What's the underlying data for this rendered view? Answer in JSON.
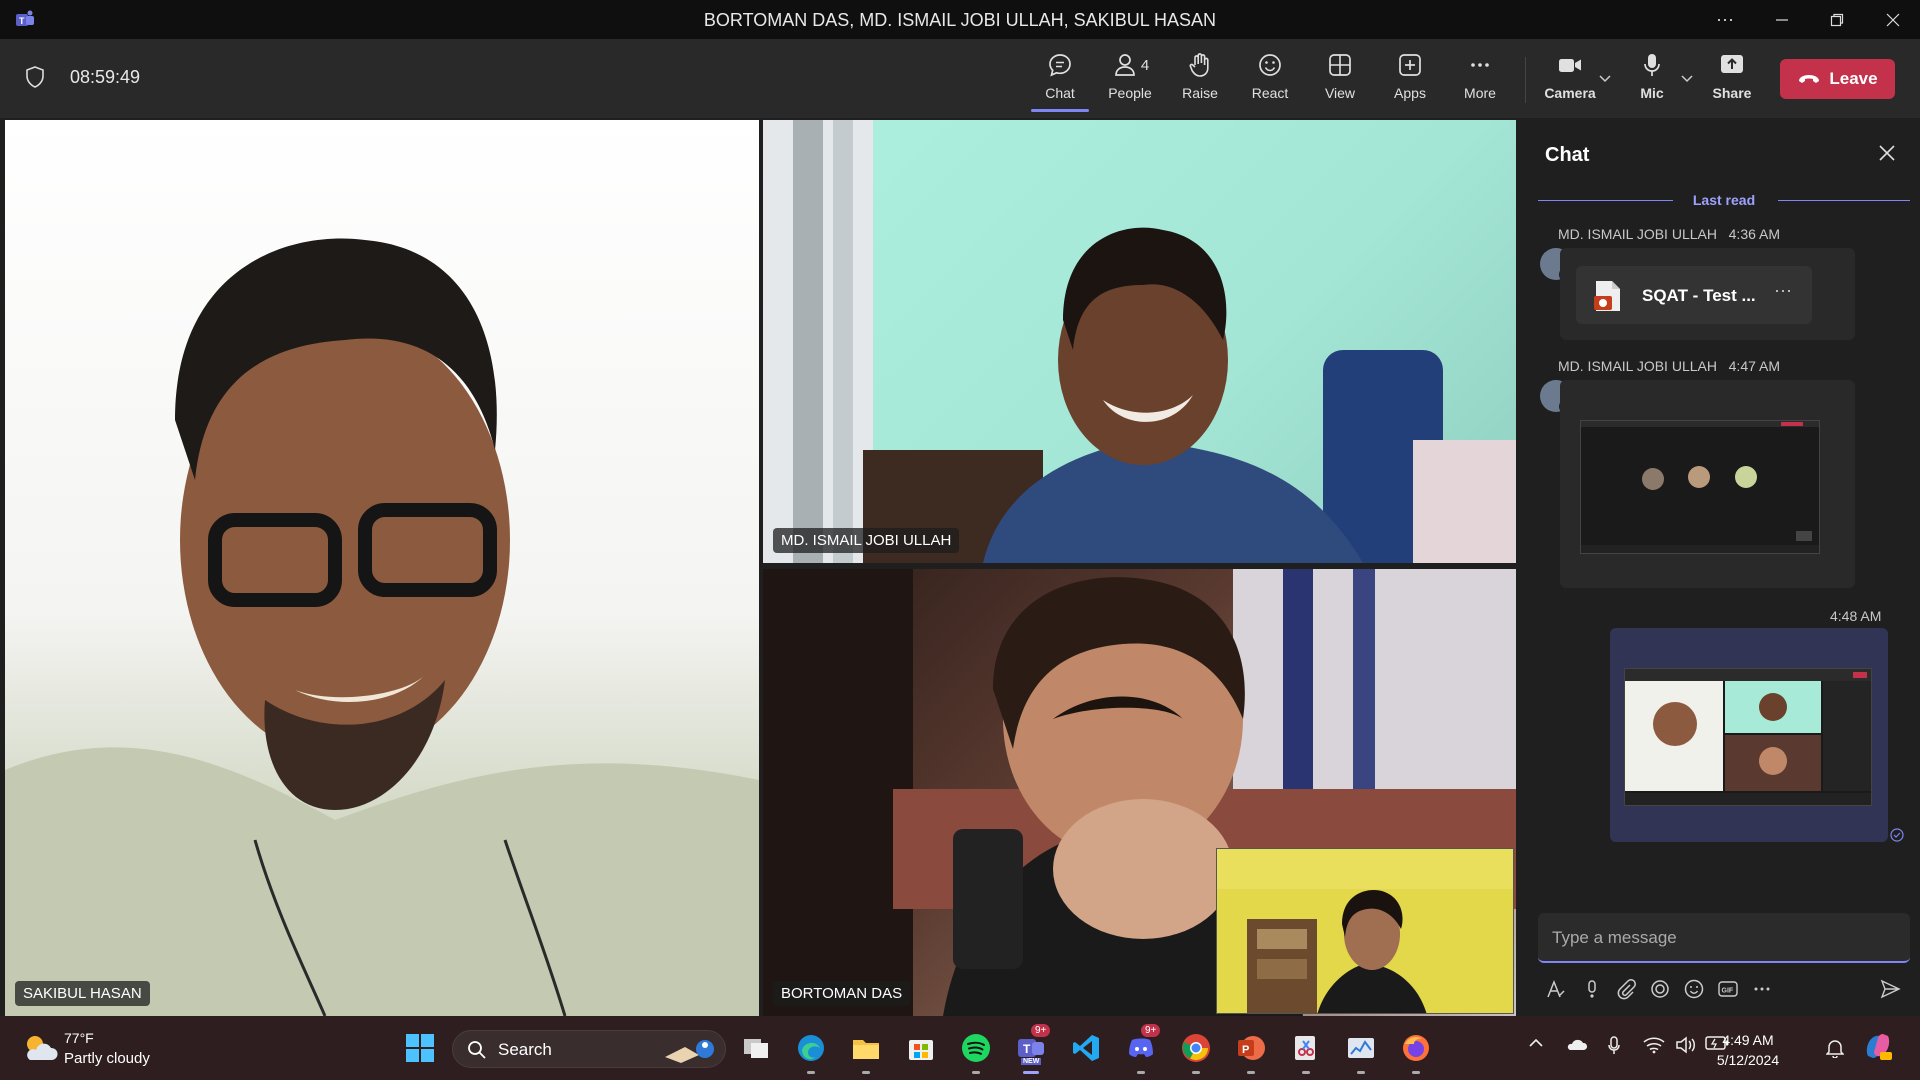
{
  "window": {
    "title": "BORTOMAN DAS, MD. ISMAIL JOBI ULLAH, SAKIBUL HASAN",
    "controls": [
      "more-options",
      "minimize",
      "restore",
      "close"
    ]
  },
  "meeting": {
    "timer": "08:59:49",
    "toolbar": {
      "chat": "Chat",
      "people": "People",
      "people_count": "4",
      "raise": "Raise",
      "react": "React",
      "view": "View",
      "apps": "Apps",
      "more": "More",
      "camera": "Camera",
      "mic": "Mic",
      "share": "Share",
      "leave": "Leave"
    },
    "participants": [
      {
        "name": "SAKIBUL HASAN"
      },
      {
        "name": "MD. ISMAIL JOBI ULLAH"
      },
      {
        "name": "BORTOMAN DAS"
      }
    ]
  },
  "chat": {
    "title": "Chat",
    "last_read": "Last read",
    "messages": [
      {
        "sender": "MD. ISMAIL JOBI ULLAH",
        "time": "4:36 AM",
        "file_name": "SQAT - Test ..."
      },
      {
        "sender": "MD. ISMAIL JOBI ULLAH",
        "time": "4:47 AM"
      },
      {
        "time": "4:48 AM"
      }
    ],
    "compose_placeholder": "Type a message"
  },
  "taskbar": {
    "weather_temp": "77°F",
    "weather_desc": "Partly cloudy",
    "search_label": "Search",
    "teams_badge": "9+",
    "teams_new": "NEW",
    "discord_badge": "9+",
    "time": "4:49 AM",
    "date": "5/12/2024"
  },
  "colors": {
    "accent": "#7f85f5",
    "leave": "#c4314b",
    "toolbar_bg": "#292929",
    "titlebar_bg": "#0f0f0f",
    "taskbar_bg": "#2e1e1f"
  }
}
